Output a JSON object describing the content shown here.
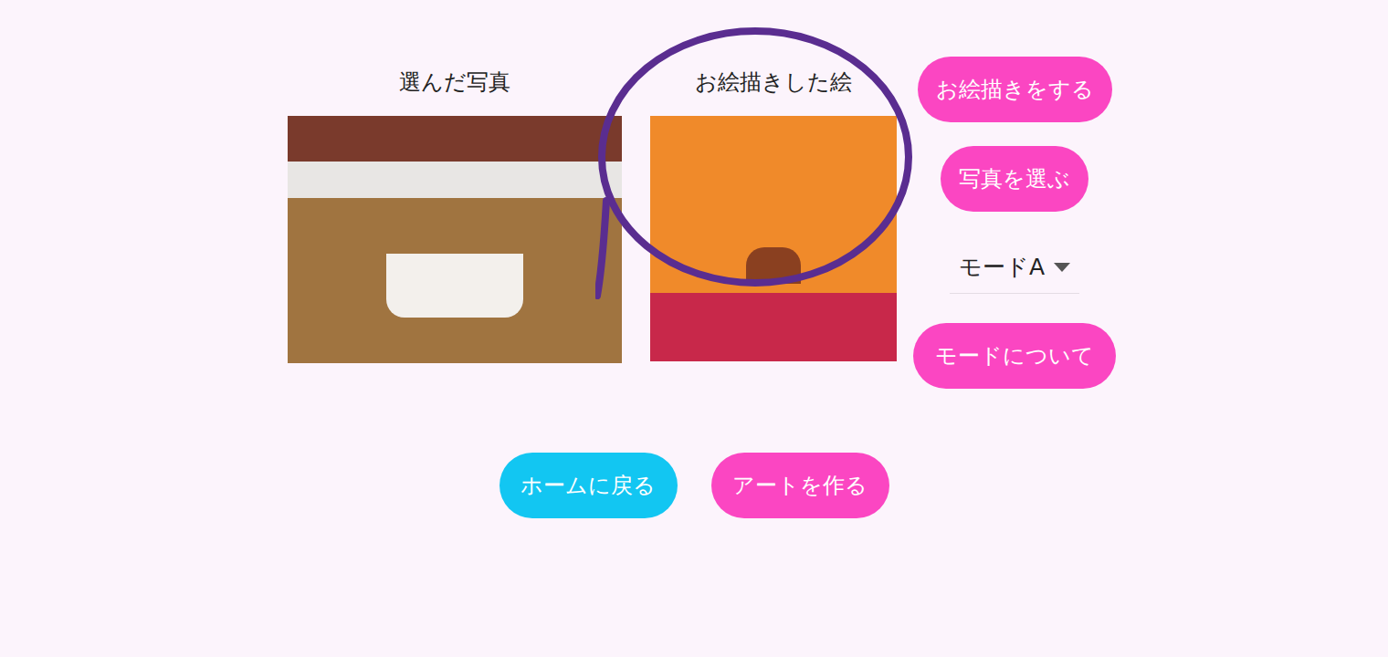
{
  "photo_panel": {
    "label": "選んだ写真"
  },
  "drawing_panel": {
    "label": "お絵描きした絵"
  },
  "side_buttons": [
    "お絵描きをする",
    "写真を選ぶ"
  ],
  "mode_select": {
    "value": "モードA"
  },
  "mode_info_button": "モードについて",
  "bottom_buttons": [
    {
      "label": "ホームに戻る",
      "kind": "secondary"
    },
    {
      "label": "アートを作る",
      "kind": "primary"
    }
  ]
}
